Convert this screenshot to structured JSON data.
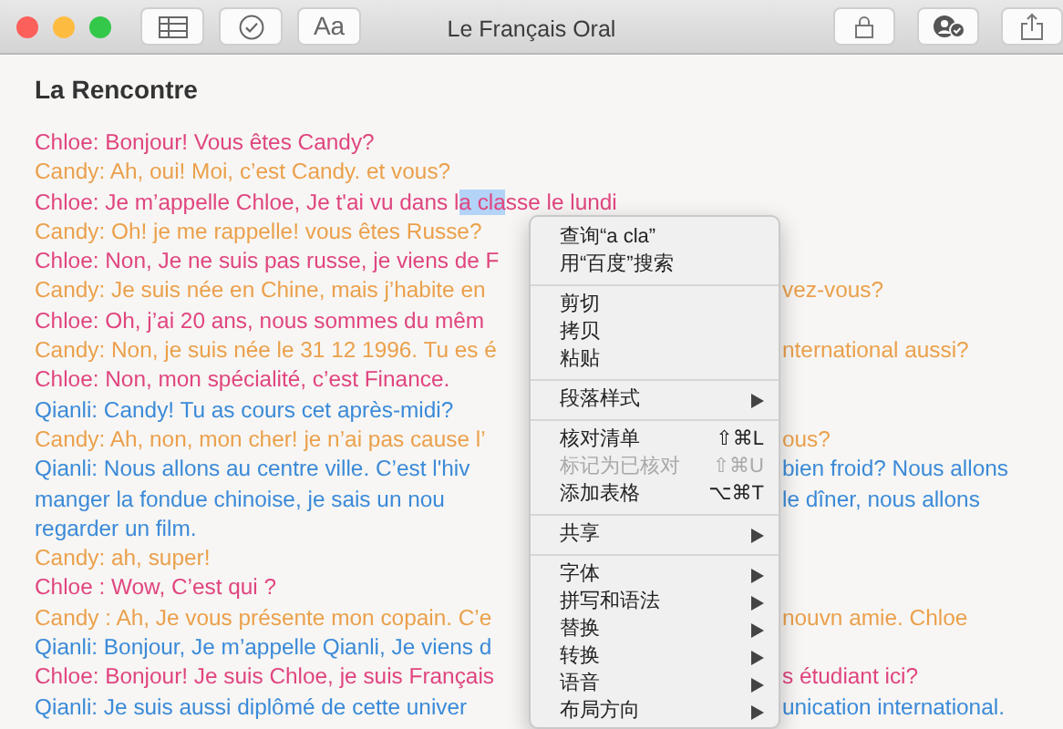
{
  "window": {
    "title": "Le Français Oral",
    "toolbar_left": [
      {
        "kind": "table"
      },
      {
        "kind": "checklist"
      },
      {
        "kind": "text",
        "label": "Aa"
      }
    ],
    "toolbar_right": [
      {
        "kind": "lock"
      },
      {
        "kind": "collaborate"
      },
      {
        "kind": "share"
      }
    ]
  },
  "note": {
    "title": "La Rencontre",
    "lines": [
      {
        "color": "#e0457f",
        "segments": [
          {
            "text": "Chloe: Bonjour! Vous êtes Candy?",
            "selected": false
          }
        ]
      },
      {
        "color": "#eba04c",
        "segments": [
          {
            "text": "Candy: Ah, oui! Moi, c’est Candy. et vous?",
            "selected": false
          }
        ]
      },
      {
        "color": "#e0457f",
        "segments": [
          {
            "text": "Chloe: Je m’appelle Chloe, Je t'ai vu dans l",
            "selected": false
          },
          {
            "text": "a cla",
            "selected": true
          },
          {
            "text": "sse le lundi",
            "selected": false
          }
        ]
      },
      {
        "color": "#eba04c",
        "segments": [
          {
            "text": "Candy: Oh! je me rappelle! vous êtes Russe?",
            "selected": false
          }
        ]
      },
      {
        "color": "#e0457f",
        "segments": [
          {
            "text": "Chloe: Non, Je ne suis pas russe, je viens de F",
            "selected": false
          }
        ]
      },
      {
        "color": "#eba04c",
        "segments": [
          {
            "text": "Candy: Je suis née en Chine, mais j’habite en",
            "selected": false
          }
        ],
        "after_menu": "vez-vous?"
      },
      {
        "color": "#e0457f",
        "segments": [
          {
            "text": "Chloe: Oh, j’ai 20 ans, nous sommes du mêm",
            "selected": false
          }
        ]
      },
      {
        "color": "#eba04c",
        "segments": [
          {
            "text": "Candy: Non, je suis née le 31 12 1996. Tu es é",
            "selected": false
          }
        ],
        "after_menu": "nternational aussi?"
      },
      {
        "color": "#e0457f",
        "segments": [
          {
            "text": "Chloe: Non, mon spécialité, c’est Finance.",
            "selected": false
          }
        ]
      },
      {
        "color": "#3b8ad8",
        "segments": [
          {
            "text": "Qianli: Candy! Tu as cours cet après-midi?",
            "selected": false
          }
        ]
      },
      {
        "color": "#eba04c",
        "segments": [
          {
            "text": "Candy: Ah, non, mon cher! je n’ai pas cause l’",
            "selected": false
          }
        ],
        "after_menu": "ous?"
      },
      {
        "color": "#3b8ad8",
        "segments": [
          {
            "text": "Qianli: Nous allons au centre ville. C’est l'hiv",
            "selected": false
          }
        ],
        "after_menu": "bien froid? Nous allons"
      },
      {
        "color": "#3b8ad8",
        "segments": [
          {
            "text": "manger la fondue chinoise, je sais un nou",
            "selected": false
          }
        ],
        "after_menu": "le dîner, nous allons"
      },
      {
        "color": "#3b8ad8",
        "segments": [
          {
            "text": "regarder un film.",
            "selected": false
          }
        ]
      },
      {
        "color": "#eba04c",
        "segments": [
          {
            "text": "Candy: ah, super!",
            "selected": false
          }
        ]
      },
      {
        "color": "#e0457f",
        "segments": [
          {
            "text": "Chloe : Wow, C’est qui ?",
            "selected": false
          }
        ]
      },
      {
        "color": "#eba04c",
        "segments": [
          {
            "text": "Candy : Ah, Je vous présente mon copain. C’e",
            "selected": false
          }
        ],
        "after_menu": "nouvn amie. Chloe"
      },
      {
        "color": "#3b8ad8",
        "segments": [
          {
            "text": "Qianli: Bonjour, Je m’appelle Qianli, Je viens d",
            "selected": false
          }
        ]
      },
      {
        "color": "#e0457f",
        "segments": [
          {
            "text": "Chloe: Bonjour! Je suis Chloe, je suis Français",
            "selected": false
          }
        ],
        "after_menu": "s étudiant ici?"
      },
      {
        "color": "#3b8ad8",
        "segments": [
          {
            "text": "Qianli: Je suis aussi diplômé de cette univer",
            "selected": false
          }
        ],
        "after_menu": "unication international."
      }
    ]
  },
  "context_menu": {
    "groups": [
      [
        {
          "label": "查询“a cla”",
          "disabled": false
        },
        {
          "label": "用“百度”搜索",
          "disabled": false
        }
      ],
      [
        {
          "label": "剪切",
          "disabled": false
        },
        {
          "label": "拷贝",
          "disabled": false
        },
        {
          "label": "粘贴",
          "disabled": false
        }
      ],
      [
        {
          "label": "段落样式",
          "disabled": false,
          "submenu": true
        }
      ],
      [
        {
          "label": "核对清单",
          "disabled": false,
          "shortcut": "⇧⌘L"
        },
        {
          "label": "标记为已核对",
          "disabled": true,
          "shortcut": "⇧⌘U"
        },
        {
          "label": "添加表格",
          "disabled": false,
          "shortcut": "⌥⌘T"
        }
      ],
      [
        {
          "label": "共享",
          "disabled": false,
          "submenu": true
        }
      ],
      [
        {
          "label": "字体",
          "disabled": false,
          "submenu": true
        },
        {
          "label": "拼写和语法",
          "disabled": false,
          "submenu": true
        },
        {
          "label": "替换",
          "disabled": false,
          "submenu": true
        },
        {
          "label": "转换",
          "disabled": false,
          "submenu": true
        },
        {
          "label": "语音",
          "disabled": false,
          "submenu": true
        },
        {
          "label": "布局方向",
          "disabled": false,
          "submenu": true
        }
      ]
    ]
  }
}
